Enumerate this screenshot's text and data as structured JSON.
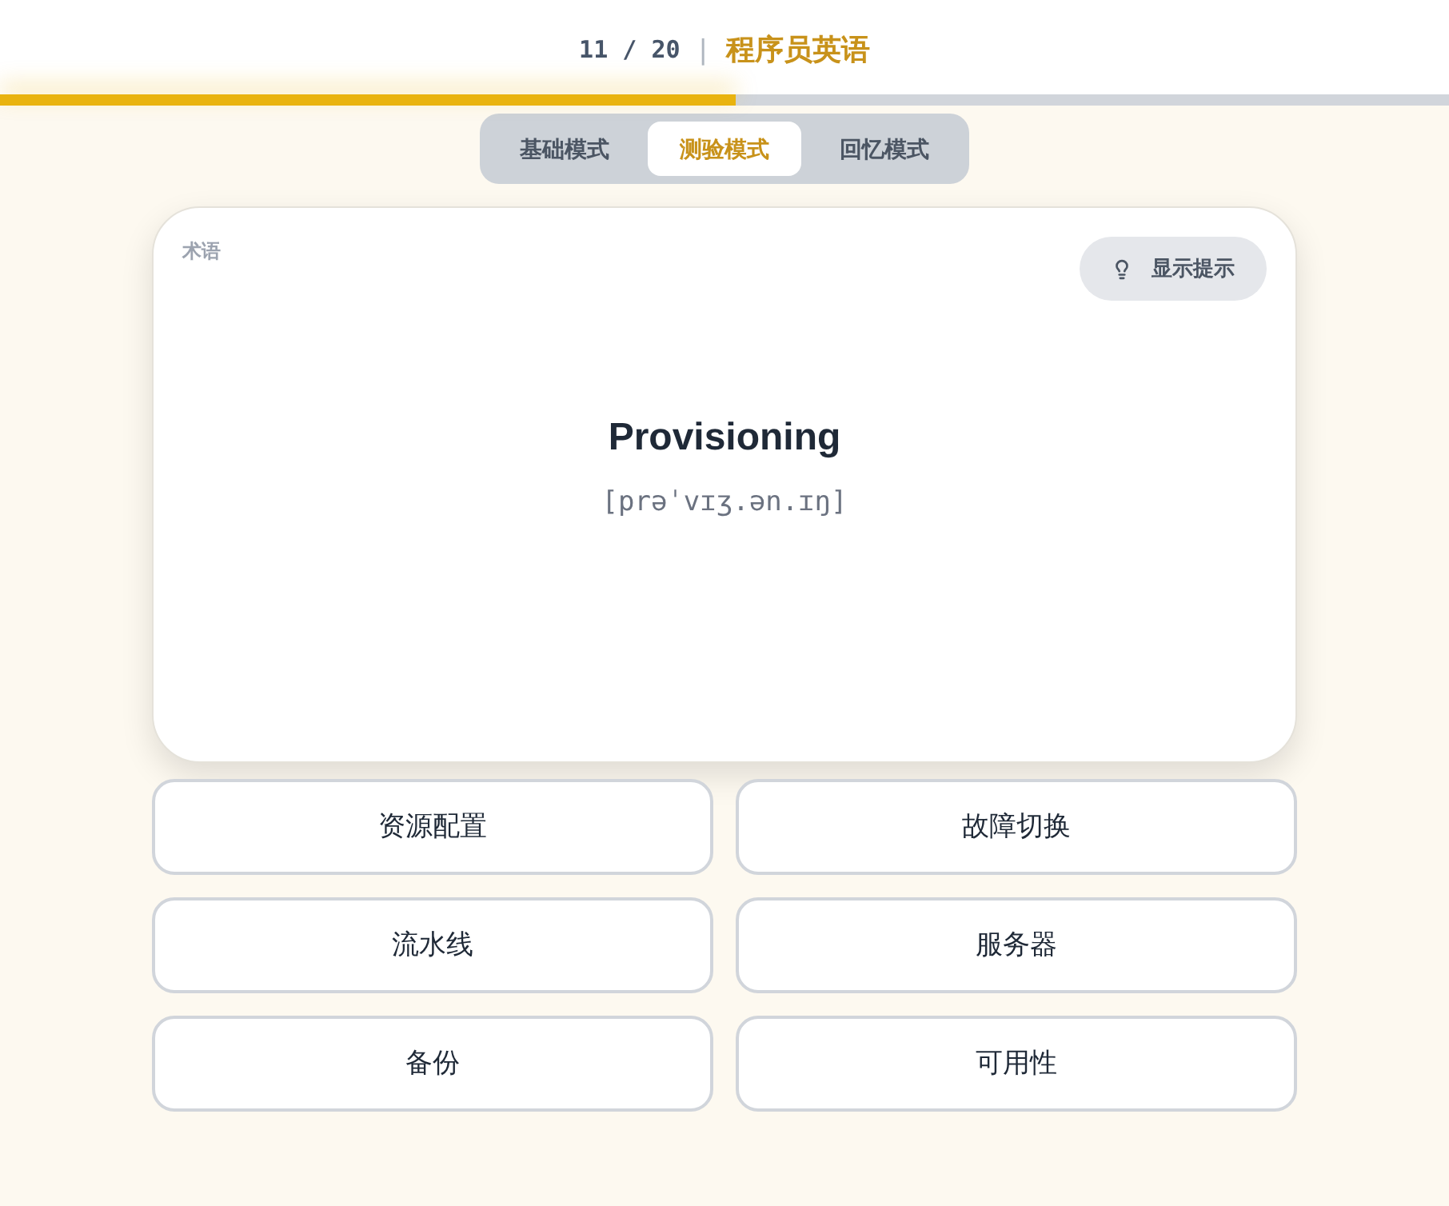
{
  "header": {
    "counter": "11 / 20",
    "separator": "|",
    "title": "程序员英语"
  },
  "progress": {
    "level": 0.508
  },
  "mode_tabs": [
    {
      "label": "基础模式",
      "selected": false
    },
    {
      "label": "测验模式",
      "selected": true
    },
    {
      "label": "回忆模式",
      "selected": false
    }
  ],
  "card": {
    "label": "术语",
    "hint_button": "显示提示",
    "word": "Provisioning",
    "phonetic": "[prəˈvɪʒ.ən.ɪŋ]"
  },
  "options": [
    "资源配置",
    "故障切换",
    "流水线",
    "服务器",
    "备份",
    "可用性"
  ]
}
